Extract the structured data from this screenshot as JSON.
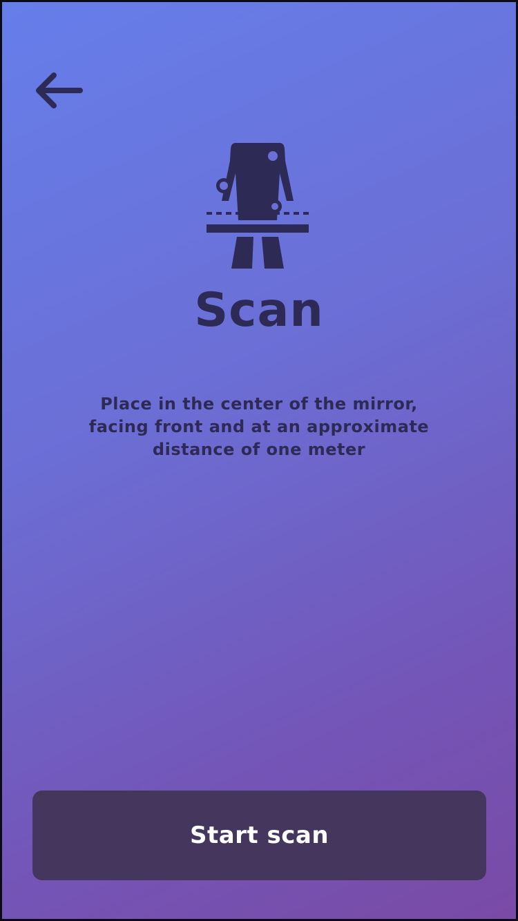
{
  "header": {
    "back_icon": "arrow-left-icon"
  },
  "hero": {
    "icon": "body-scan-icon",
    "title": "Scan",
    "instructions": "Place in the center of the mirror, facing front and at an approximate distance of one meter"
  },
  "footer": {
    "start_label": "Start scan"
  },
  "colors": {
    "gradient_start": "#667eea",
    "gradient_end": "#7a4aa6",
    "text_dark": "#2d2b55",
    "button_bg": "#44365d",
    "button_text": "#ffffff"
  }
}
